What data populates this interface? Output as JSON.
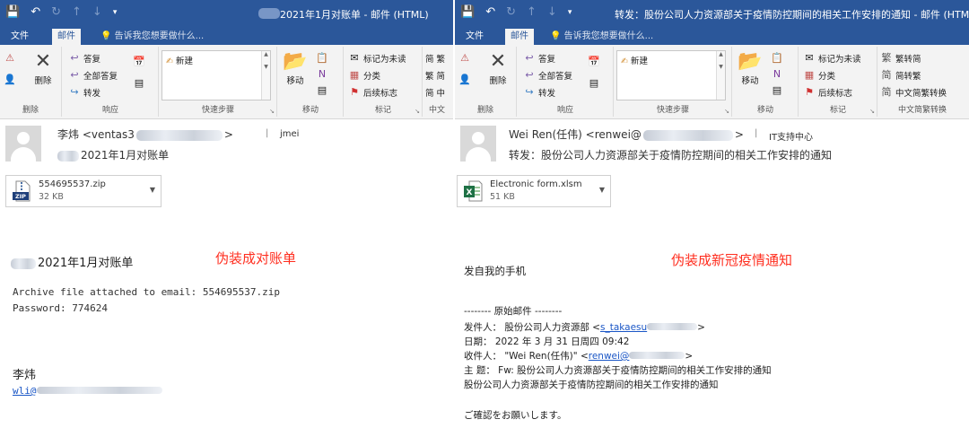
{
  "left": {
    "window_title": "2021年1月对账单 - 邮件 (HTML)",
    "tabs": [
      "文件",
      "邮件"
    ],
    "tell_me": "告诉我您想要做什么...",
    "ribbon": {
      "ignore_label": "",
      "delete": "删除",
      "reply": "答复",
      "reply_all": "全部答复",
      "forward": "转发",
      "quick_new": "新建",
      "move": "移动",
      "mark_unread": "标记为未读",
      "categorize": "分类",
      "followup": "后续标志",
      "trad1": "简 繁",
      "trad2": "繁 简",
      "trad3": "简 中",
      "groups": {
        "delete": "删除",
        "respond": "响应",
        "quick_steps": "快速步骤",
        "move": "移动",
        "tags": "标记",
        "chinese": "中文"
      }
    },
    "header": {
      "from_name": "李炜 <ventas3",
      "from_end": ">",
      "to": "jmei",
      "subject": "2021年1月对账单"
    },
    "attachment": {
      "name": "554695537.zip",
      "size": "32 KB",
      "icon": "zip-icon",
      "badge": "ZIP"
    },
    "body": {
      "heading": "2021年1月对账单",
      "line1": "Archive file attached to email: 554695537.zip",
      "line2": "Password: 774624",
      "sig_name": "李炜",
      "sig_email": "wli@"
    },
    "annotation": "伪装成对账单"
  },
  "right": {
    "window_title": "转发：股份公司人力资源部关于疫情防控期间的相关工作安排的通知 - 邮件 (HTML)",
    "tabs": [
      "文件",
      "邮件"
    ],
    "tell_me": "告诉我您想要做什么...",
    "ribbon": {
      "delete": "删除",
      "reply": "答复",
      "reply_all": "全部答复",
      "forward": "转发",
      "quick_new": "新建",
      "move": "移动",
      "mark_unread": "标记为未读",
      "categorize": "分类",
      "followup": "后续标志",
      "to_trad": "繁转简",
      "to_simp": "简转繁",
      "convert": "中文简繁转换",
      "groups": {
        "delete": "删除",
        "respond": "响应",
        "quick_steps": "快速步骤",
        "move": "移动",
        "tags": "标记",
        "chinese": "中文简繁转换"
      }
    },
    "header": {
      "from_name": "Wei Ren(任伟) <renwei@",
      "from_end": ">",
      "to": "IT支持中心",
      "subject": "转发：股份公司人力资源部关于疫情防控期间的相关工作安排的通知"
    },
    "attachment": {
      "name": "Electronic form.xlsm",
      "size": "51 KB",
      "icon": "excel-icon",
      "badge": "X"
    },
    "body": {
      "line1": "发自我的手机",
      "orig": "-------- 原始邮件 --------",
      "from_label": "发件人： 股份公司人力资源部 <",
      "from_link": "s_takaesu",
      "from_tail": ">",
      "date": "日期： 2022 年 3 月 31 日周四 09:42",
      "to_label": "收件人： \"Wei Ren(任伟)\" <",
      "to_link": "renwei@",
      "to_tail": ">",
      "subject": "主 题： Fw: 股份公司人力资源部关于疫情防控期间的相关工作安排的通知",
      "line_title": "股份公司人力资源部关于疫情防控期间的相关工作安排的通知",
      "closing": "ご確認をお願いします。"
    },
    "annotation": "伪装成新冠疫情通知"
  },
  "colors": {
    "title_bar": "#2b579a",
    "ribbon": "#f3f3f3",
    "annotation": "#ff2e1f",
    "link": "#1a56c6"
  }
}
